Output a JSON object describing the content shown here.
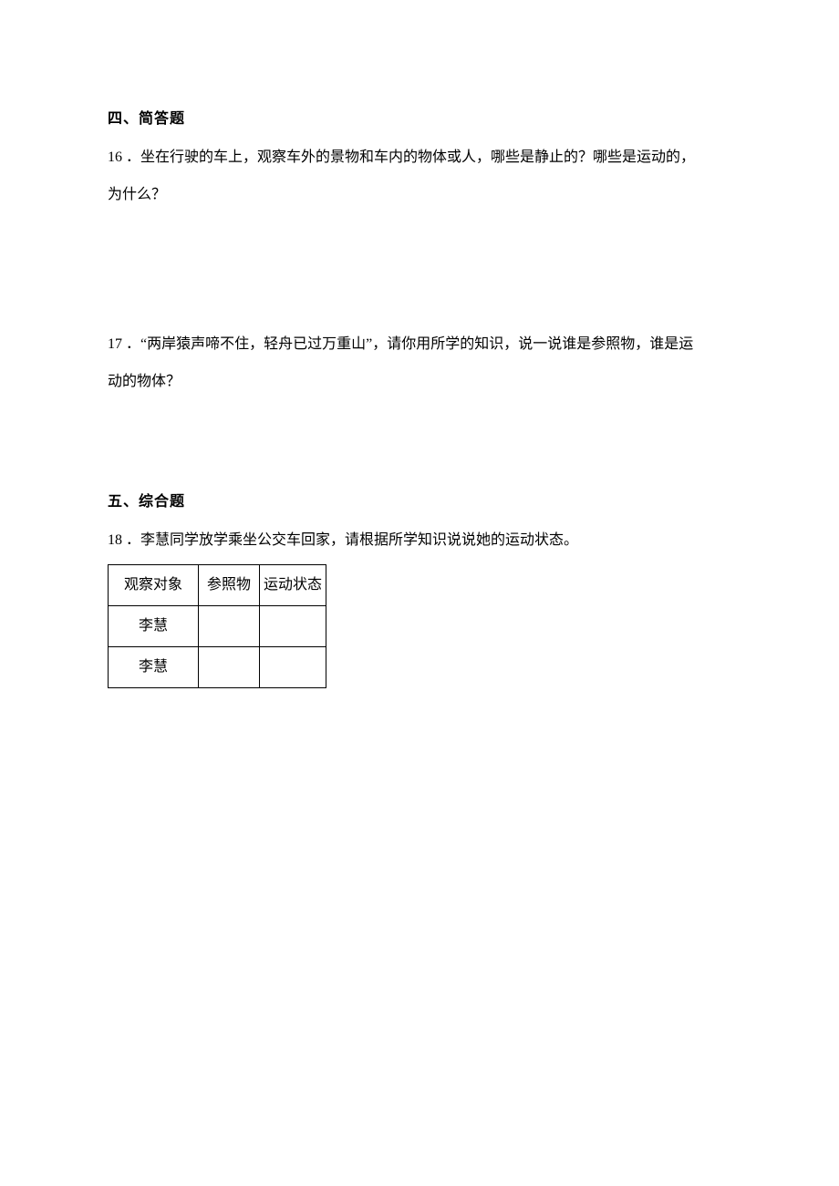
{
  "section4": {
    "heading": "四、简答题",
    "q16": {
      "num": "16 ．",
      "line1": "坐在行驶的车上，观察车外的景物和车内的物体或人，哪些是静止的？哪些是运动的，",
      "line2": "为什么？"
    },
    "q17": {
      "num": "17 ．",
      "line1": "“两岸猿声啼不住，轻舟已过万重山”，请你用所学的知识，说一说谁是参照物，谁是运",
      "line2": "动的物体？"
    }
  },
  "section5": {
    "heading": "五、综合题",
    "q18": {
      "num": "18 ．",
      "text": "李慧同学放学乘坐公交车回家，请根据所学知识说说她的运动状态。"
    },
    "table": {
      "h1": "观察对象",
      "h2": "参照物",
      "h3": "运动状态",
      "row1c1": "李慧",
      "row1c2": "",
      "row1c3": "",
      "row2c1": "李慧",
      "row2c2": "",
      "row2c3": ""
    }
  }
}
